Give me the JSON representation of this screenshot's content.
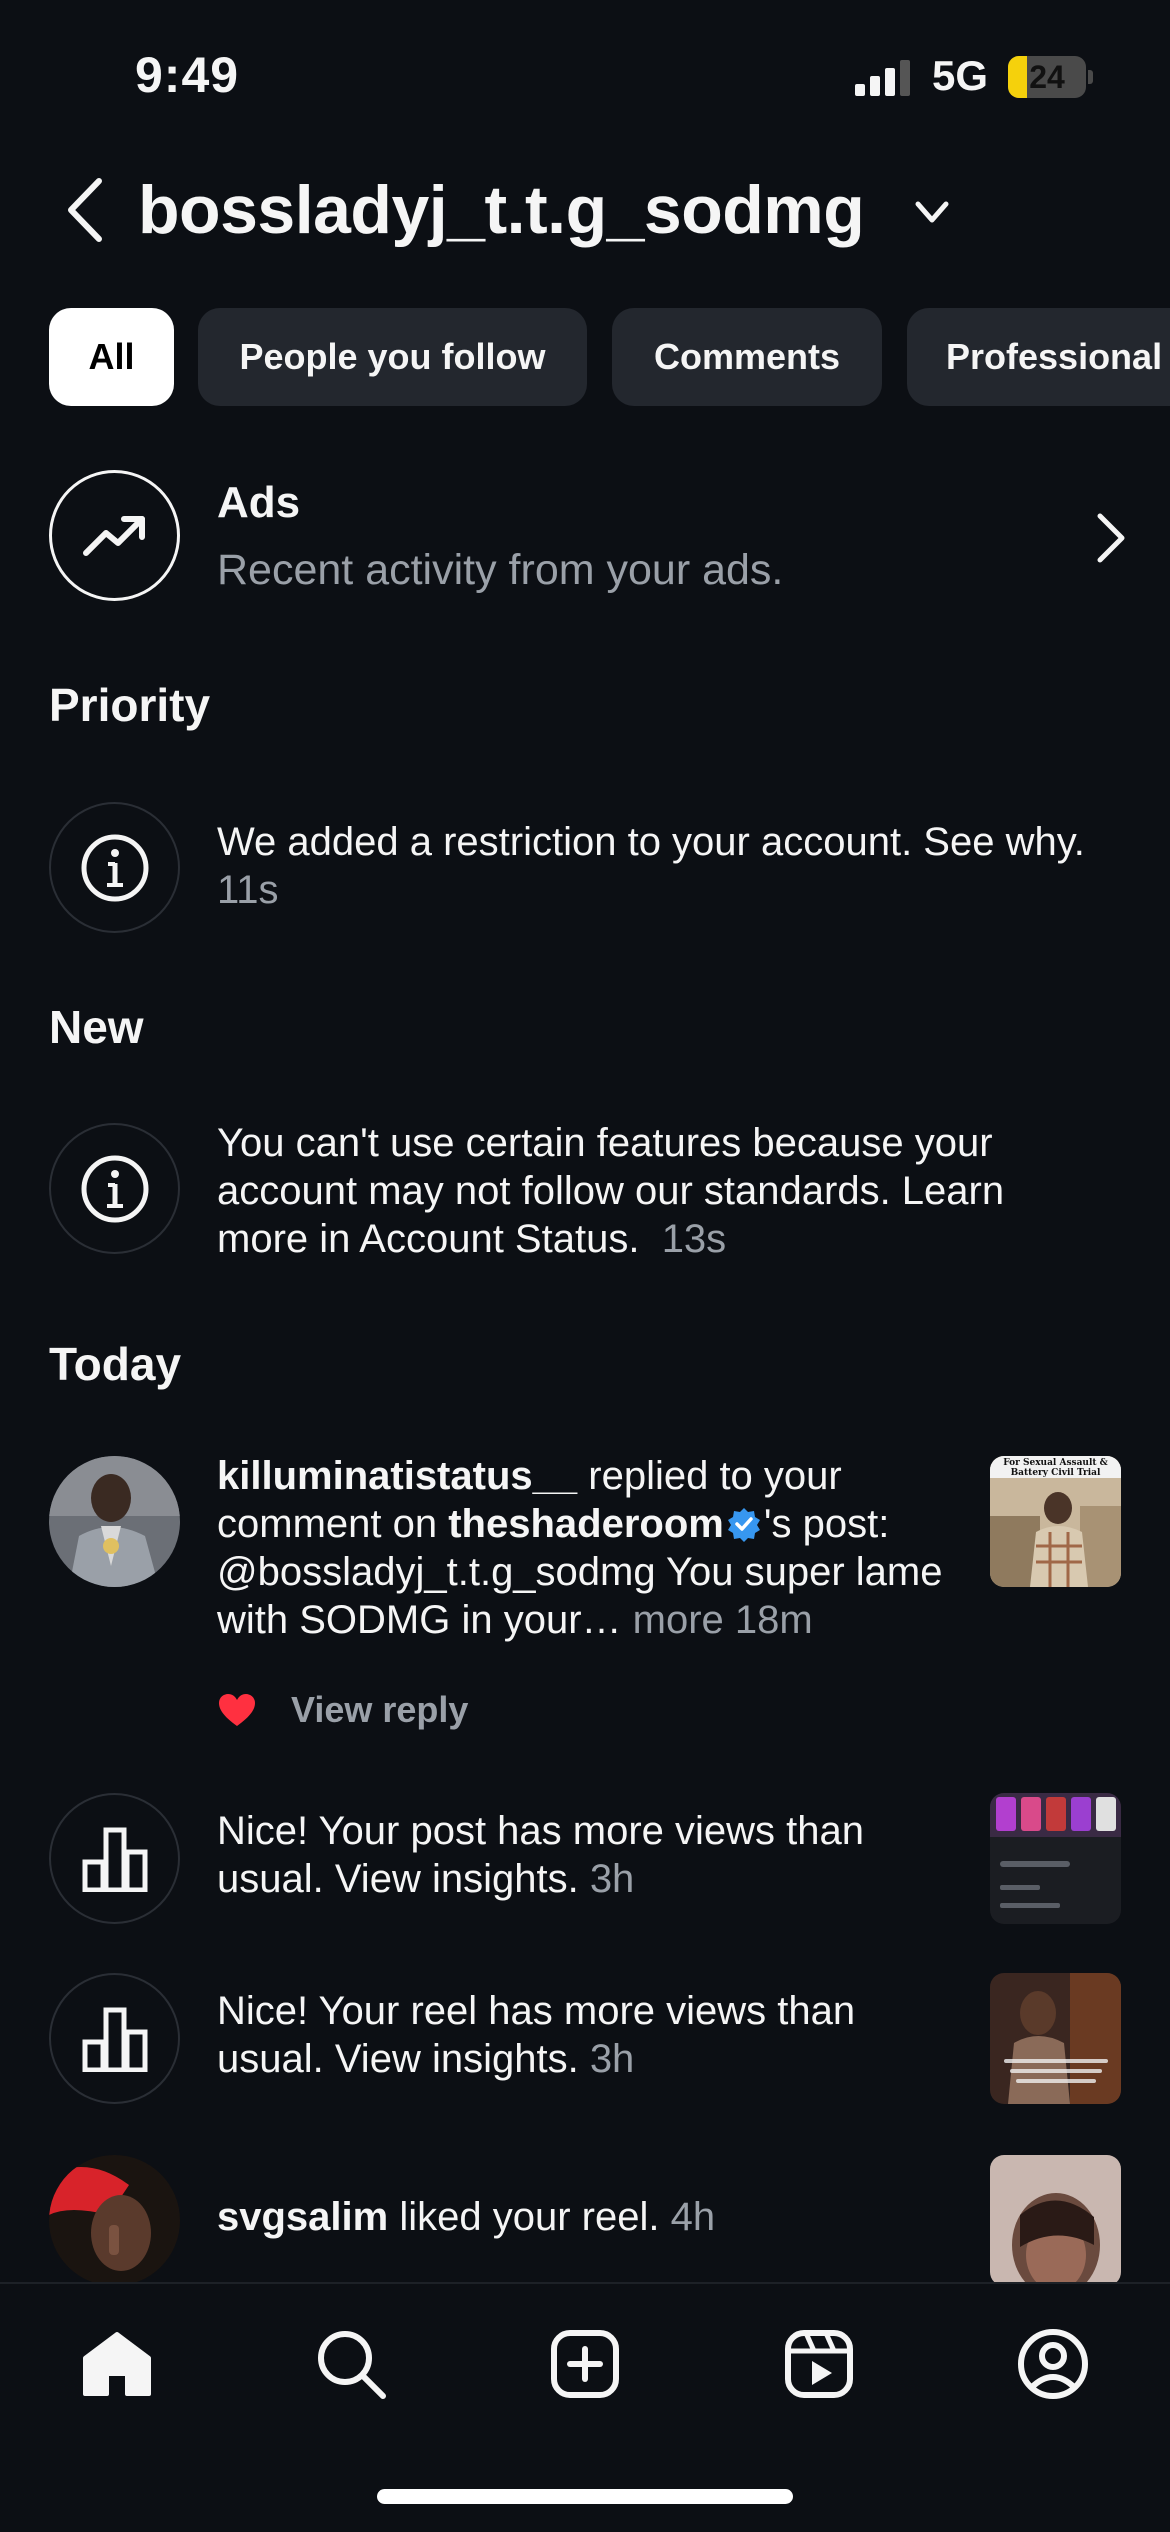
{
  "status_bar": {
    "time": "9:49",
    "network": "5G",
    "battery_percent": "24",
    "battery_level": 0.24,
    "battery_color": "#f5d10c"
  },
  "header": {
    "account_name": "bossladyj_t.t.g_sodmg",
    "back_icon": "chevron-left-icon",
    "dropdown_icon": "chevron-down-icon"
  },
  "filters": {
    "chips": [
      {
        "label": "All",
        "active": true
      },
      {
        "label": "People you follow",
        "active": false
      },
      {
        "label": "Comments",
        "active": false
      },
      {
        "label": "Professional",
        "active": false
      }
    ]
  },
  "ads": {
    "title": "Ads",
    "subtitle": "Recent activity from your ads.",
    "icon": "trending-up-icon"
  },
  "sections": {
    "priority": "Priority",
    "new": "New",
    "today": "Today"
  },
  "priority_item": {
    "text": "We added a restriction to your account. See why.",
    "time": "11s",
    "icon": "info-icon"
  },
  "new_item": {
    "text": "You can't use certain features because your account may not follow our standards. Learn more in Account Status.",
    "time": "13s",
    "icon": "info-icon"
  },
  "today_items": {
    "comment": {
      "username": "killuminatistatus__",
      "action_1": "replied to your comment on",
      "post_owner": "theshaderoom",
      "action_2": "'s post:",
      "comment_text": "@bossladyj_t.t.g_sodmg You super lame with SODMG in your…",
      "more": "more",
      "time": "18m",
      "view_reply": "View reply",
      "thumb_caption": "For Sexual Assault & Battery Civil Trial"
    },
    "post_insight": {
      "text": "Nice! Your post has more views than usual. View insights.",
      "time": "3h",
      "icon": "bar-chart-icon"
    },
    "reel_insight": {
      "text": "Nice! Your reel has more views than usual. View insights.",
      "time": "3h",
      "icon": "bar-chart-icon"
    },
    "like": {
      "username": "svgsalim",
      "action": "liked your reel.",
      "time": "4h"
    }
  },
  "nav": {
    "items": [
      "home-icon",
      "search-icon",
      "create-icon",
      "reels-icon",
      "profile-icon"
    ]
  },
  "colors": {
    "background": "#0c0f14",
    "chip": "#23272e",
    "muted": "#9aa0a8",
    "verified": "#3797f0",
    "heart": "#ff3040"
  }
}
